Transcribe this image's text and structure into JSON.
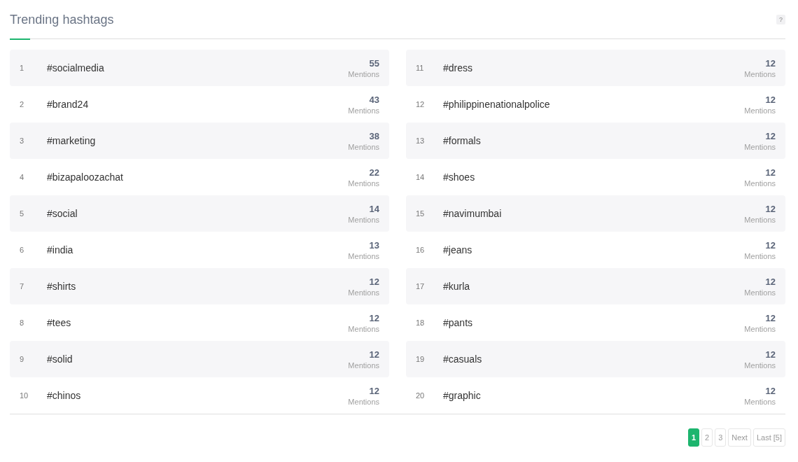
{
  "title": "Trending hashtags",
  "help": "?",
  "columns": [
    [
      {
        "rank": "1",
        "tag": "#socialmedia",
        "count": "55",
        "unit": "Mentions"
      },
      {
        "rank": "2",
        "tag": "#brand24",
        "count": "43",
        "unit": "Mentions"
      },
      {
        "rank": "3",
        "tag": "#marketing",
        "count": "38",
        "unit": "Mentions"
      },
      {
        "rank": "4",
        "tag": "#bizapaloozachat",
        "count": "22",
        "unit": "Mentions"
      },
      {
        "rank": "5",
        "tag": "#social",
        "count": "14",
        "unit": "Mentions"
      },
      {
        "rank": "6",
        "tag": "#india",
        "count": "13",
        "unit": "Mentions"
      },
      {
        "rank": "7",
        "tag": "#shirts",
        "count": "12",
        "unit": "Mentions"
      },
      {
        "rank": "8",
        "tag": "#tees",
        "count": "12",
        "unit": "Mentions"
      },
      {
        "rank": "9",
        "tag": "#solid",
        "count": "12",
        "unit": "Mentions"
      },
      {
        "rank": "10",
        "tag": "#chinos",
        "count": "12",
        "unit": "Mentions"
      }
    ],
    [
      {
        "rank": "11",
        "tag": "#dress",
        "count": "12",
        "unit": "Mentions"
      },
      {
        "rank": "12",
        "tag": "#philippinenationalpolice",
        "count": "12",
        "unit": "Mentions"
      },
      {
        "rank": "13",
        "tag": "#formals",
        "count": "12",
        "unit": "Mentions"
      },
      {
        "rank": "14",
        "tag": "#shoes",
        "count": "12",
        "unit": "Mentions"
      },
      {
        "rank": "15",
        "tag": "#navimumbai",
        "count": "12",
        "unit": "Mentions"
      },
      {
        "rank": "16",
        "tag": "#jeans",
        "count": "12",
        "unit": "Mentions"
      },
      {
        "rank": "17",
        "tag": "#kurla",
        "count": "12",
        "unit": "Mentions"
      },
      {
        "rank": "18",
        "tag": "#pants",
        "count": "12",
        "unit": "Mentions"
      },
      {
        "rank": "19",
        "tag": "#casuals",
        "count": "12",
        "unit": "Mentions"
      },
      {
        "rank": "20",
        "tag": "#graphic",
        "count": "12",
        "unit": "Mentions"
      }
    ]
  ],
  "pagination": [
    {
      "label": "1",
      "selected": true
    },
    {
      "label": "2",
      "selected": false
    },
    {
      "label": "3",
      "selected": false
    },
    {
      "label": "Next",
      "selected": false
    },
    {
      "label": "Last [5]",
      "selected": false
    }
  ]
}
